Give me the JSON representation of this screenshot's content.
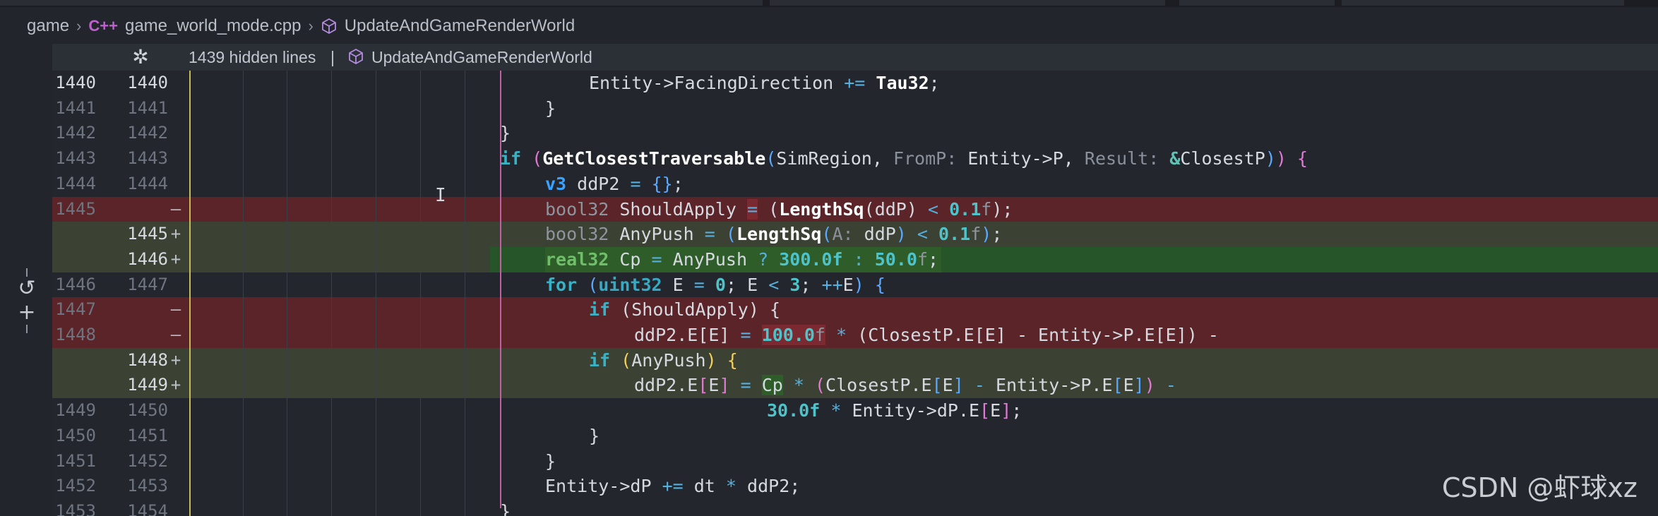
{
  "breadcrumb": {
    "folder": "game",
    "file": "game_world_mode.cpp",
    "cpp_icon": "C++",
    "symbol": "UpdateAndGameRenderWorld"
  },
  "sticky_header": {
    "hidden_lines": "1439 hidden lines",
    "separator": "|",
    "function": "UpdateAndGameRenderWorld"
  },
  "watermark": "CSDN @虾球xz",
  "gutter": {
    "icons": [
      "revert-icon",
      "add-icon"
    ]
  },
  "lines": [
    {
      "l": "1440",
      "r": "1440",
      "mark": "",
      "kind": "normal"
    },
    {
      "l": "1441",
      "r": "1441",
      "mark": "",
      "kind": "normal"
    },
    {
      "l": "1442",
      "r": "1442",
      "mark": "",
      "kind": "normal"
    },
    {
      "l": "1443",
      "r": "1443",
      "mark": "",
      "kind": "normal"
    },
    {
      "l": "1444",
      "r": "1444",
      "mark": "",
      "kind": "normal"
    },
    {
      "l": "1445",
      "r": "",
      "mark": "—",
      "kind": "del"
    },
    {
      "l": "",
      "r": "1445",
      "mark": "+",
      "kind": "ins"
    },
    {
      "l": "",
      "r": "1446",
      "mark": "+",
      "kind": "ins2"
    },
    {
      "l": "1446",
      "r": "1447",
      "mark": "",
      "kind": "normal"
    },
    {
      "l": "1447",
      "r": "",
      "mark": "—",
      "kind": "del"
    },
    {
      "l": "1448",
      "r": "",
      "mark": "—",
      "kind": "del"
    },
    {
      "l": "",
      "r": "1448",
      "mark": "+",
      "kind": "ins"
    },
    {
      "l": "",
      "r": "1449",
      "mark": "+",
      "kind": "ins"
    },
    {
      "l": "1449",
      "r": "1450",
      "mark": "",
      "kind": "normal"
    },
    {
      "l": "1450",
      "r": "1451",
      "mark": "",
      "kind": "normal"
    },
    {
      "l": "1451",
      "r": "1452",
      "mark": "",
      "kind": "normal"
    },
    {
      "l": "1452",
      "r": "1453",
      "mark": "",
      "kind": "normal"
    },
    {
      "l": "1453",
      "r": "1454",
      "mark": "",
      "kind": "normal"
    }
  ],
  "code": {
    "c0": "Entity->FacingDirection ",
    "c0_op": "+=",
    "c0_val": "Tau32",
    "c0_end": ";",
    "c1": "}",
    "c2": "}",
    "c3_kw": "if",
    "c3_fn": "GetClosestTraversable",
    "c3_a1": "SimRegion,",
    "c3_h1": "FromP:",
    "c3_a2": "Entity->P,",
    "c3_h2": "Result:",
    "c3_a3": "&ClosestP",
    "c4_ty": "v3",
    "c4_rest": "ddP2",
    "c5_ty": "bool32",
    "c5_var": "ShouldApply",
    "c5_fn": "LengthSq",
    "c5_arg": "ddP",
    "c5_num": "0.1",
    "c5_suf": "f",
    "c6_ty": "bool32",
    "c6_var": "AnyPush",
    "c6_fn": "LengthSq",
    "c6_hint": "A:",
    "c6_arg": "ddP",
    "c6_num": "0.1",
    "c6_suf": "f",
    "c7_ty": "real32",
    "c7_var": "Cp",
    "c7_cond": "AnyPush",
    "c7_n1": "300.0f",
    "c7_n2": "50.0",
    "c7_suf": "f",
    "c8_kw": "for",
    "c8_ty": "uint32",
    "c8_e": "E",
    "c8_n0": "0",
    "c8_n3": "3",
    "c9_kw": "if",
    "c9_var": "ShouldApply",
    "c10_lhs": "ddP2.E[E]",
    "c10_num": "100.0",
    "c10_suf": "f",
    "c10_rest": "(ClosestP.E[E] - Entity->P.E[E]) -",
    "c11_kw": "if",
    "c11_var": "AnyPush",
    "c12_lhs": "ddP2.E",
    "c12_e": "E",
    "c12_cp": "Cp",
    "c12_rest": "ClosestP.E",
    "c12_rest2": "Entity->P.E",
    "c13_num": "30.0f",
    "c13_rest": "Entity->dP.E",
    "c16_lhs": "Entity->dP",
    "c16_rest": "dt",
    "c16_end": "ddP2;"
  }
}
